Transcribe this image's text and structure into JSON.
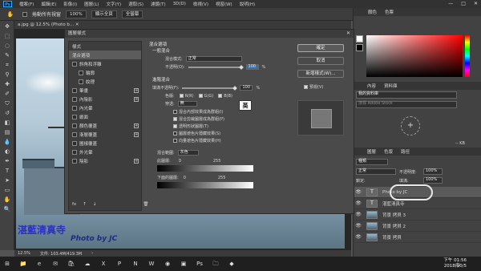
{
  "app": {
    "name": "Ps"
  },
  "menubar": [
    "檔案(F)",
    "編輯(E)",
    "影像(I)",
    "圖層(L)",
    "文字(Y)",
    "選取(S)",
    "濾鏡(T)",
    "3D(D)",
    "檢視(V)",
    "視窗(W)",
    "說明(H)"
  ],
  "window_controls": [
    "—",
    "□",
    "✕"
  ],
  "options_bar": {
    "checkbox_label": "捲動所有視窗",
    "zoom": "100%",
    "fit_button": "顯示全頁",
    "fill_button": "全螢幕"
  },
  "document": {
    "tab": "a.jpg @ 12.5% (Photo b... ✕",
    "caption_cn": "湛藍清真寺",
    "caption_en": "Photo by JC",
    "status_zoom": "12.5%",
    "status_doc": "文件: 103.4M/419.3M"
  },
  "right_panel": {
    "color_tabs": [
      "顏色",
      "色票"
    ],
    "properties_tabs": [
      "內容",
      "資料庫"
    ],
    "library_select": "我的資料庫",
    "library_search": "搜尋 Adobe Stock",
    "library_size": "-- KB",
    "layers_tabs": [
      "圖層",
      "色版",
      "路徑"
    ],
    "layer_kind": "種類",
    "blend_mode": "正常",
    "opacity_label": "不透明度:",
    "opacity": "100%",
    "lock_label": "鎖定:",
    "fill_label": "填滿:",
    "fill": "100%",
    "layers": [
      {
        "name": "Photo by JC",
        "type": "text"
      },
      {
        "name": "湛藍清真寺",
        "type": "text"
      },
      {
        "name": "背景 拷貝 3",
        "type": "image"
      },
      {
        "name": "背景 拷貝 2",
        "type": "image"
      },
      {
        "name": "背景 拷貝",
        "type": "image"
      }
    ]
  },
  "dialog": {
    "title": "圖層樣式",
    "close": "✕",
    "styles": [
      {
        "label": "樣式",
        "checkbox": false,
        "plus": false
      },
      {
        "label": "混合選項",
        "checkbox": false,
        "plus": false,
        "active": true
      },
      {
        "label": "斜角和浮雕",
        "checkbox": true,
        "plus": false
      },
      {
        "label": "輪廓",
        "checkbox": true,
        "plus": false,
        "indent": true
      },
      {
        "label": "紋理",
        "checkbox": true,
        "plus": false,
        "indent": true
      },
      {
        "label": "筆畫",
        "checkbox": true,
        "plus": true
      },
      {
        "label": "內陰影",
        "checkbox": true,
        "plus": true
      },
      {
        "label": "內光暈",
        "checkbox": true,
        "plus": false
      },
      {
        "label": "緞面",
        "checkbox": true,
        "plus": false
      },
      {
        "label": "顏色覆蓋",
        "checkbox": true,
        "plus": true
      },
      {
        "label": "漸層覆蓋",
        "checkbox": true,
        "plus": true
      },
      {
        "label": "圖樣覆蓋",
        "checkbox": true,
        "plus": false
      },
      {
        "label": "外光暈",
        "checkbox": true,
        "plus": false
      },
      {
        "label": "陰影",
        "checkbox": true,
        "plus": true
      }
    ],
    "bottom_icons": [
      "fx",
      "↑",
      "↓",
      "🗑"
    ],
    "blend_options_title": "混合選項",
    "general_title": "一般混合",
    "blend_mode_label": "混合模式:",
    "blend_mode": "正常",
    "opacity_label": "不透明(O):",
    "opacity_value": "100",
    "percent": "%",
    "advanced_title": "進階混合",
    "fill_opacity_label": "填滿不透明(F):",
    "fill_opacity_value": "100",
    "channels_label": "色版:",
    "channels": [
      "R(R)",
      "G(G)",
      "B(B)"
    ],
    "knockout_label": "穿透:",
    "knockout_value": "無",
    "checkboxes": [
      {
        "label": "混合內部效果成為群組(I)",
        "on": false
      },
      {
        "label": "混合剪裁圖層成為群組(P)",
        "on": true
      },
      {
        "label": "透明形狀圖層(T)",
        "on": true
      },
      {
        "label": "圖層遮色片隱藏效果(S)",
        "on": false
      },
      {
        "label": "向量遮色片隱藏效果(H)",
        "on": false
      }
    ],
    "blend_if_label": "混合範圍:",
    "blend_if_value": "灰色",
    "this_layer_label": "此圖層:",
    "this_layer_min": "0",
    "this_layer_max": "255",
    "underlying_label": "下面的圖層:",
    "underlying_min": "0",
    "underlying_max": "255",
    "ok": "確定",
    "cancel": "取消",
    "new_style": "新增樣式(W)...",
    "preview_label": "預視(V)",
    "tooltip": "英"
  },
  "taskbar": {
    "time": "下午 01:56",
    "date": "2018/10/5",
    "lang": "中"
  }
}
